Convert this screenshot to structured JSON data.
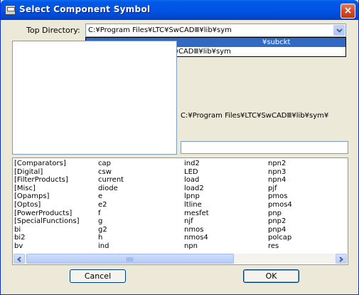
{
  "window": {
    "title": "Select Component Symbol",
    "close_label": "×"
  },
  "top_directory": {
    "label": "Top Directory:",
    "value": "C:¥Program Files¥LTC¥SwCADⅢ¥lib¥sym",
    "options": [
      {
        "text": "¥subckt",
        "selected": true
      },
      {
        "text": "C:¥Program Files¥LTC¥SwCADⅢ¥lib¥sym",
        "selected": false
      }
    ]
  },
  "current_path": "C:¥Program Files¥LTC¥SwCADⅢ¥lib¥sym¥",
  "component_name": "",
  "symbols": {
    "columns": [
      [
        "[Comparators]",
        "[Digital]",
        "[FilterProducts]",
        "[Misc]",
        "[Opamps]",
        "[Optos]",
        "[PowerProducts]",
        "[SpecialFunctions]",
        "bi",
        "bi2",
        "bv"
      ],
      [
        "cap",
        "csw",
        "current",
        "diode",
        "e",
        "e2",
        "f",
        "g",
        "g2",
        "h",
        "ind"
      ],
      [
        "ind2",
        "LED",
        "load",
        "load2",
        "lpnp",
        "ltline",
        "mesfet",
        "njf",
        "nmos",
        "nmos4",
        "npn"
      ],
      [
        "npn2",
        "npn3",
        "npn4",
        "pjf",
        "pmos",
        "pmos4",
        "pnp",
        "pnp2",
        "pnp4",
        "polcap",
        "res"
      ]
    ]
  },
  "buttons": {
    "cancel": "Cancel",
    "ok": "OK"
  },
  "colors": {
    "titlebar": "#0054e3",
    "selection": "#316ac5",
    "dialog_bg": "#ece9d8",
    "close": "#d24c2a"
  }
}
